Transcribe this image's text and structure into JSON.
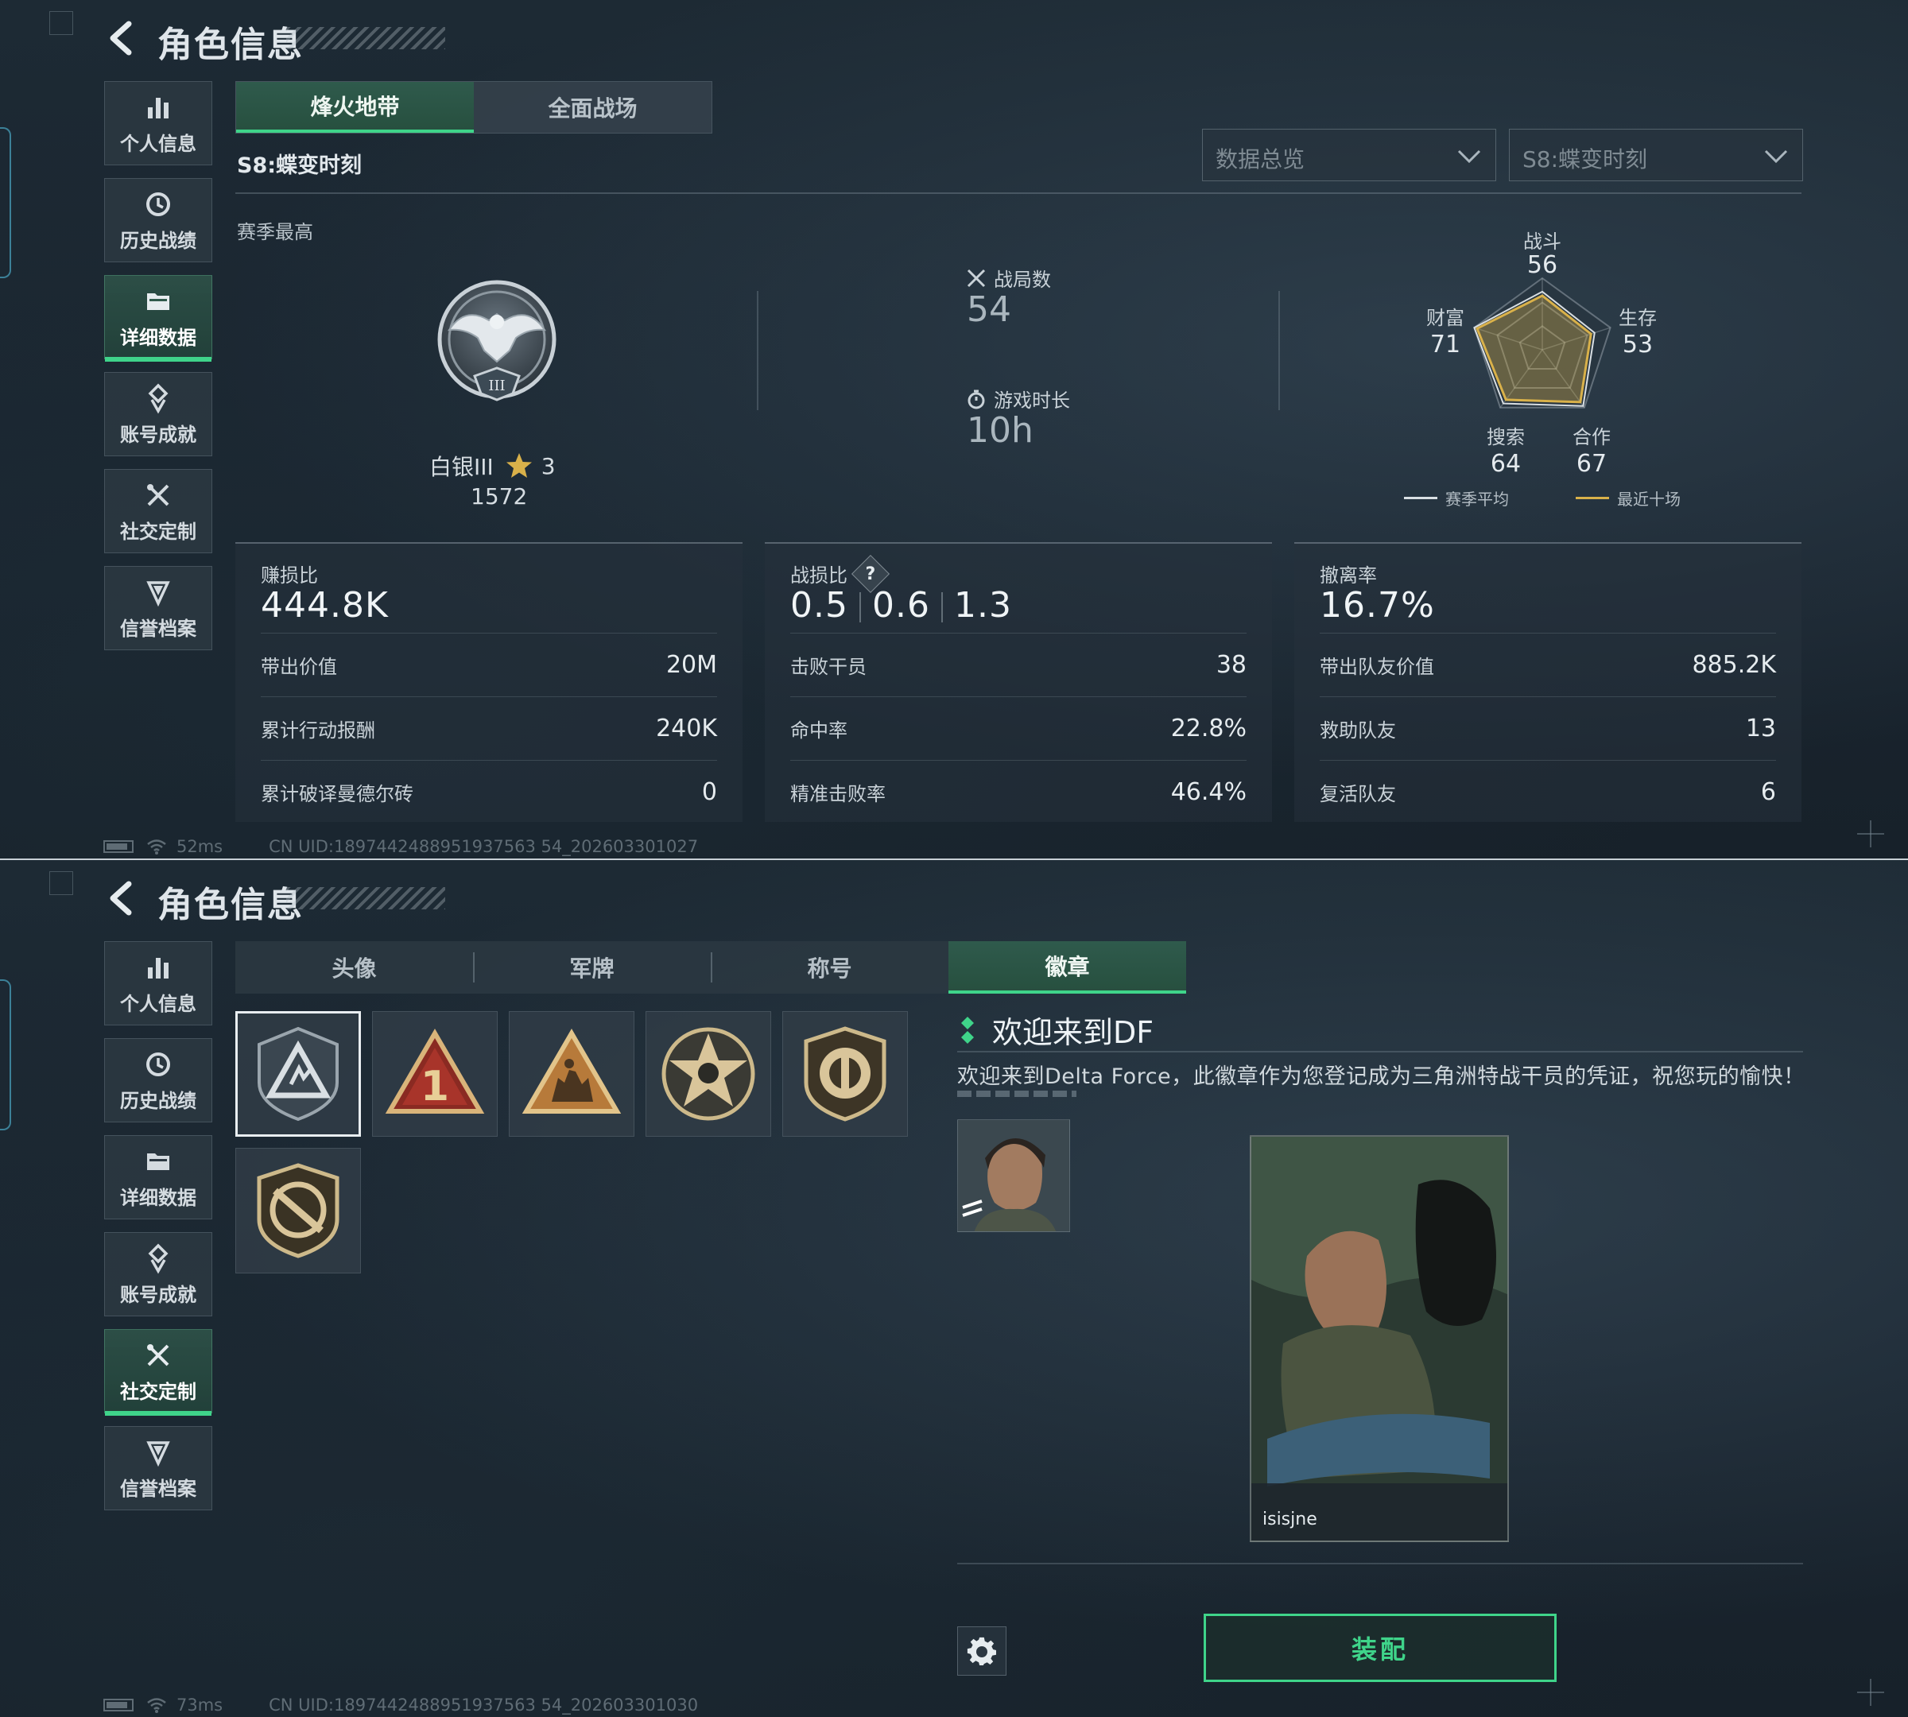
{
  "screen_top": {
    "title": "角色信息",
    "sidebar": [
      {
        "label": "个人信息",
        "icon": "bar-chart-icon"
      },
      {
        "label": "历史战绩",
        "icon": "history-clock-icon"
      },
      {
        "label": "详细数据",
        "icon": "folder-icon",
        "active": true
      },
      {
        "label": "账号成就",
        "icon": "achievement-icon"
      },
      {
        "label": "社交定制",
        "icon": "tools-icon"
      },
      {
        "label": "信誉档案",
        "icon": "reputation-icon"
      }
    ],
    "mode_tabs": [
      {
        "label": "烽火地带",
        "active": true
      },
      {
        "label": "全面战场"
      }
    ],
    "season": "S8:蝶变时刻",
    "dropdowns": {
      "overview": "数据总览",
      "season": "S8:蝶变时刻"
    },
    "season_best_label": "赛季最高",
    "rank": {
      "name": "白银III",
      "stars": "3",
      "score": "1572",
      "emblem_numeral": "III"
    },
    "matches_label": "战局数",
    "matches_value": "54",
    "playtime_label": "游戏时长",
    "playtime_value": "10h",
    "radar": {
      "labels": {
        "combat": "战斗",
        "survival": "生存",
        "coop": "合作",
        "search": "搜索",
        "wealth": "财富"
      },
      "values": {
        "combat": "56",
        "survival": "53",
        "coop": "67",
        "search": "64",
        "wealth": "71"
      },
      "legend": {
        "season_avg": "赛季平均",
        "recent_ten": "最近十场"
      },
      "colors": {
        "season_avg": "#d9dfe3",
        "recent_ten": "#d9b14a"
      }
    },
    "panels": {
      "profit": {
        "head": "赚损比",
        "main": "444.8K",
        "rows": [
          {
            "k": "带出价值",
            "v": "20M"
          },
          {
            "k": "累计行动报酬",
            "v": "240K"
          },
          {
            "k": "累计破译曼德尔砖",
            "v": "0"
          }
        ]
      },
      "kd": {
        "head": "战损比",
        "q": "?",
        "values": [
          "0.5",
          "0.6",
          "1.3"
        ],
        "rows": [
          {
            "k": "击败干员",
            "v": "38"
          },
          {
            "k": "命中率",
            "v": "22.8%"
          },
          {
            "k": "精准击败率",
            "v": "46.4%"
          }
        ]
      },
      "extract": {
        "head": "撤离率",
        "main": "16.7%",
        "rows": [
          {
            "k": "带出队友价值",
            "v": "885.2K"
          },
          {
            "k": "救助队友",
            "v": "13"
          },
          {
            "k": "复活队友",
            "v": "6"
          }
        ]
      }
    },
    "status": {
      "ping": "52ms",
      "uid": "CN UID:1897442488951937563 54_202603301027"
    }
  },
  "screen_bottom": {
    "title": "角色信息",
    "sidebar": [
      {
        "label": "个人信息",
        "icon": "bar-chart-icon"
      },
      {
        "label": "历史战绩",
        "icon": "history-clock-icon"
      },
      {
        "label": "详细数据",
        "icon": "folder-icon"
      },
      {
        "label": "账号成就",
        "icon": "achievement-icon"
      },
      {
        "label": "社交定制",
        "icon": "tools-icon",
        "active": true
      },
      {
        "label": "信誉档案",
        "icon": "reputation-icon"
      }
    ],
    "category_tabs": [
      {
        "label": "头像"
      },
      {
        "label": "军牌"
      },
      {
        "label": "称号"
      },
      {
        "label": "徽章",
        "active": true
      }
    ],
    "badges": [
      {
        "icon": "delta-shield-badge-icon",
        "selected": true
      },
      {
        "icon": "triangle-one-badge-icon"
      },
      {
        "icon": "triangle-soldiers-badge-icon"
      },
      {
        "icon": "star-skull-badge-icon"
      },
      {
        "icon": "circle-shield-badge-icon"
      },
      {
        "icon": "crossed-shield-badge-icon"
      }
    ],
    "detail": {
      "title": "欢迎来到DF",
      "description": "欢迎来到Delta Force，此徽章作为您登记成为三角洲特战干员的凭证，祝您玩的愉快！",
      "card_name": "isisjne"
    },
    "equip_label": "装配",
    "status": {
      "ping": "73ms",
      "uid": "CN UID:1897442488951937563 54_202603301030"
    }
  },
  "colors": {
    "accent_green": "#3fd48a",
    "gold": "#d9b14a",
    "bg": "#1b2630"
  }
}
